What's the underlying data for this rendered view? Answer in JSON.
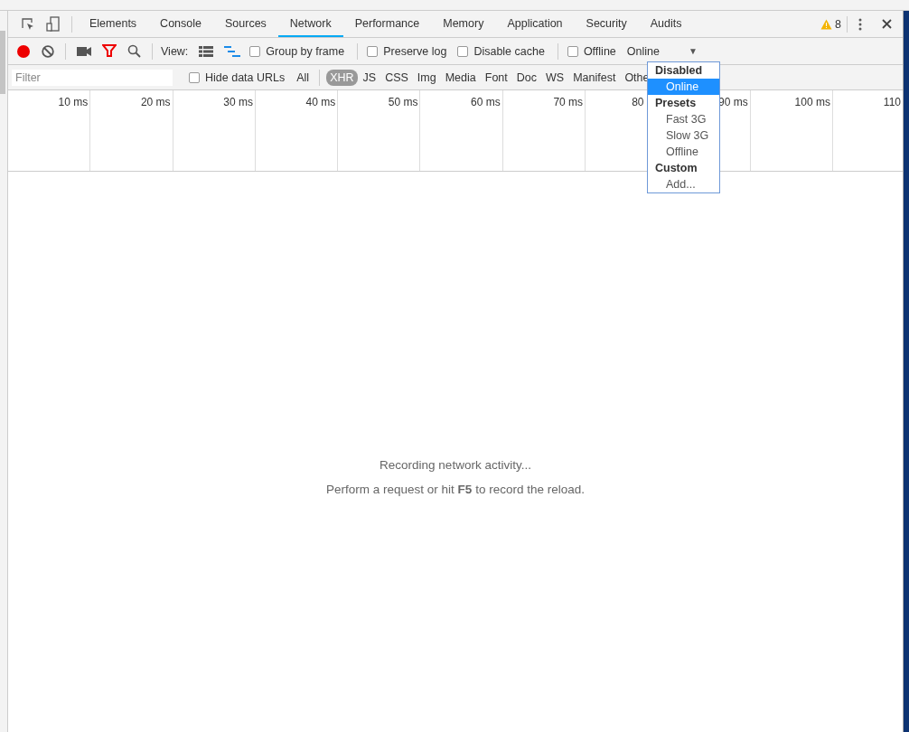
{
  "tabs": [
    {
      "label": "Elements",
      "selected": false
    },
    {
      "label": "Console",
      "selected": false
    },
    {
      "label": "Sources",
      "selected": false
    },
    {
      "label": "Network",
      "selected": true
    },
    {
      "label": "Performance",
      "selected": false
    },
    {
      "label": "Memory",
      "selected": false
    },
    {
      "label": "Application",
      "selected": false
    },
    {
      "label": "Security",
      "selected": false
    },
    {
      "label": "Audits",
      "selected": false
    }
  ],
  "warnings": "8",
  "toolbar": {
    "recording": true,
    "filter_on": true,
    "view_label": "View:",
    "large_rows": false,
    "overview": true,
    "checkboxes": [
      {
        "label": "Group by frame",
        "checked": false
      },
      {
        "label": "Preserve log",
        "checked": false
      },
      {
        "label": "Disable cache",
        "checked": false
      },
      {
        "label": "Offline",
        "checked": false
      }
    ],
    "throttle": {
      "value": "Online",
      "arrow": "▼"
    }
  },
  "filter_bar": {
    "placeholder": "Filter",
    "hide_data_urls": {
      "label": "Hide data URLs",
      "checked": false
    },
    "types": [
      {
        "label": "All",
        "selected": false
      },
      {
        "label": "XHR",
        "selected": true
      },
      {
        "label": "JS",
        "selected": false
      },
      {
        "label": "CSS",
        "selected": false
      },
      {
        "label": "Img",
        "selected": false
      },
      {
        "label": "Media",
        "selected": false
      },
      {
        "label": "Font",
        "selected": false
      },
      {
        "label": "Doc",
        "selected": false
      },
      {
        "label": "WS",
        "selected": false
      },
      {
        "label": "Manifest",
        "selected": false
      },
      {
        "label": "Othe",
        "selected": false
      }
    ]
  },
  "timeline": {
    "ticks": [
      {
        "label": "10 ms",
        "kind": "full"
      },
      {
        "label": "20 ms",
        "kind": "full"
      },
      {
        "label": "30 ms",
        "kind": "full"
      },
      {
        "label": "40 ms",
        "kind": "full"
      },
      {
        "label": "50 ms",
        "kind": "full"
      },
      {
        "label": "60 ms",
        "kind": "full"
      },
      {
        "label": "70 ms",
        "kind": "full"
      },
      {
        "label": "80",
        "kind": "cut"
      },
      {
        "label": "90 ms",
        "kind": "full"
      },
      {
        "label": "100 ms",
        "kind": "full"
      },
      {
        "label": "110",
        "kind": "full"
      }
    ]
  },
  "throttle_menu": [
    {
      "kind": "group",
      "label": "Disabled"
    },
    {
      "kind": "option",
      "label": "Online",
      "selected": true
    },
    {
      "kind": "group",
      "label": "Presets"
    },
    {
      "kind": "option",
      "label": "Fast 3G",
      "selected": false
    },
    {
      "kind": "option",
      "label": "Slow 3G",
      "selected": false
    },
    {
      "kind": "option",
      "label": "Offline",
      "selected": false
    },
    {
      "kind": "group",
      "label": "Custom"
    },
    {
      "kind": "option",
      "label": "Add...",
      "selected": false
    }
  ],
  "empty_state": {
    "title": "Recording network activity...",
    "hint": "Perform a request or hit **F5** to record the reload."
  }
}
